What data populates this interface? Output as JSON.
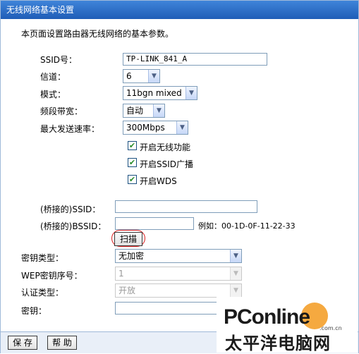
{
  "title": "无线网络基本设置",
  "description": "本页面设置路由器无线网络的基本参数。",
  "fields": {
    "ssid": {
      "label": "SSID号：",
      "value": "TP-LINK_841_A"
    },
    "channel": {
      "label": "信道：",
      "value": "6"
    },
    "mode": {
      "label": "模式：",
      "value": "11bgn mixed"
    },
    "bandwidth": {
      "label": "频段带宽：",
      "value": "自动"
    },
    "max_rate": {
      "label": "最大发送速率：",
      "value": "300Mbps"
    }
  },
  "checkboxes": [
    {
      "label": "开启无线功能",
      "checked": true
    },
    {
      "label": "开启SSID广播",
      "checked": true
    },
    {
      "label": "开启WDS",
      "checked": true
    }
  ],
  "wds": {
    "bridged_ssid_label": "(桥接的)SSID：",
    "bridged_ssid_value": "",
    "bridged_bssid_label": "(桥接的)BSSID：",
    "bridged_bssid_value": "",
    "example_text": "例如：00-1D-0F-11-22-33",
    "scan_button": "扫描",
    "key_type_label": "密钥类型：",
    "key_type_value": "无加密",
    "wep_index_label": "WEP密钥序号：",
    "wep_index_value": "1",
    "auth_type_label": "认证类型：",
    "auth_type_value": "开放",
    "key_label": "密钥：",
    "key_value": ""
  },
  "footer": {
    "save_label": "保 存",
    "help_label": "帮 助"
  },
  "watermark": {
    "brand": "PConline",
    "sub": "太平洋电脑网",
    "domain": ".com.cn"
  },
  "colors": {
    "title_bar": "#2a6ac8",
    "accent_ring": "#dd2222"
  },
  "icons": {
    "dropdown": "chevron-down-icon",
    "checkbox": "checkmark-icon"
  }
}
